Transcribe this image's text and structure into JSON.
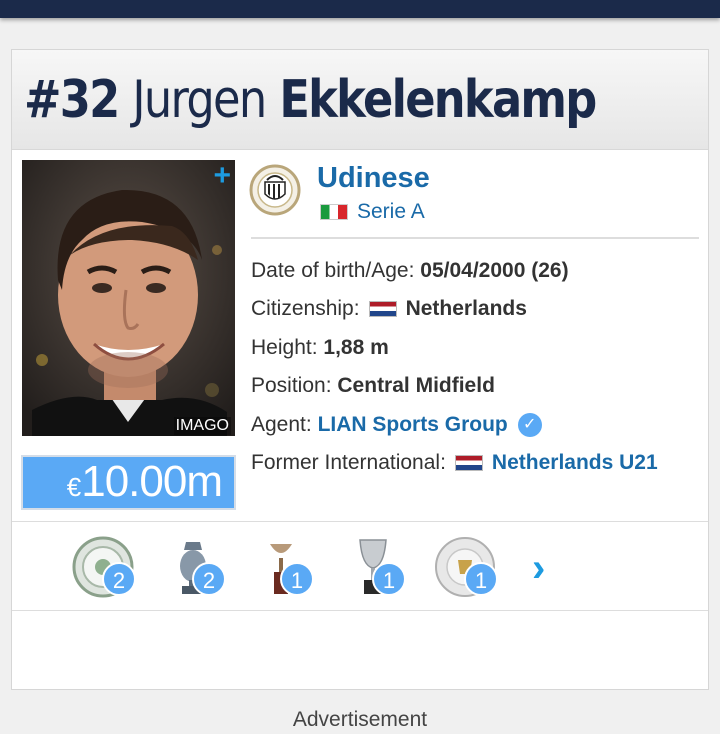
{
  "player": {
    "number": "#32",
    "first_name": "Jurgen",
    "last_name": "Ekkelenkamp",
    "photo_credit": "IMAGO",
    "market_value_currency": "€",
    "market_value_amount": "10.00m"
  },
  "club": {
    "name": "Udinese",
    "league": "Serie A"
  },
  "info": {
    "dob_label": "Date of birth/Age:",
    "dob_value": "05/04/2000 (26)",
    "citizenship_label": "Citizenship:",
    "citizenship_value": "Netherlands",
    "height_label": "Height:",
    "height_value": "1,88 m",
    "position_label": "Position:",
    "position_value": "Central Midfield",
    "agent_label": "Agent:",
    "agent_value": "LIAN Sports Group",
    "former_int_label": "Former International:",
    "former_int_value": "Netherlands U21"
  },
  "trophies": [
    {
      "icon": "league-plate-icon",
      "count": "2"
    },
    {
      "icon": "cup-trophy-icon",
      "count": "2"
    },
    {
      "icon": "small-trophy-icon",
      "count": "1"
    },
    {
      "icon": "silver-cup-icon",
      "count": "1"
    },
    {
      "icon": "shield-plate-icon",
      "count": "1"
    }
  ],
  "footer": {
    "advertisement": "Advertisement"
  },
  "colors": {
    "navy": "#1b2a4a",
    "link": "#1a6aa8",
    "accent": "#5aa9f5"
  }
}
